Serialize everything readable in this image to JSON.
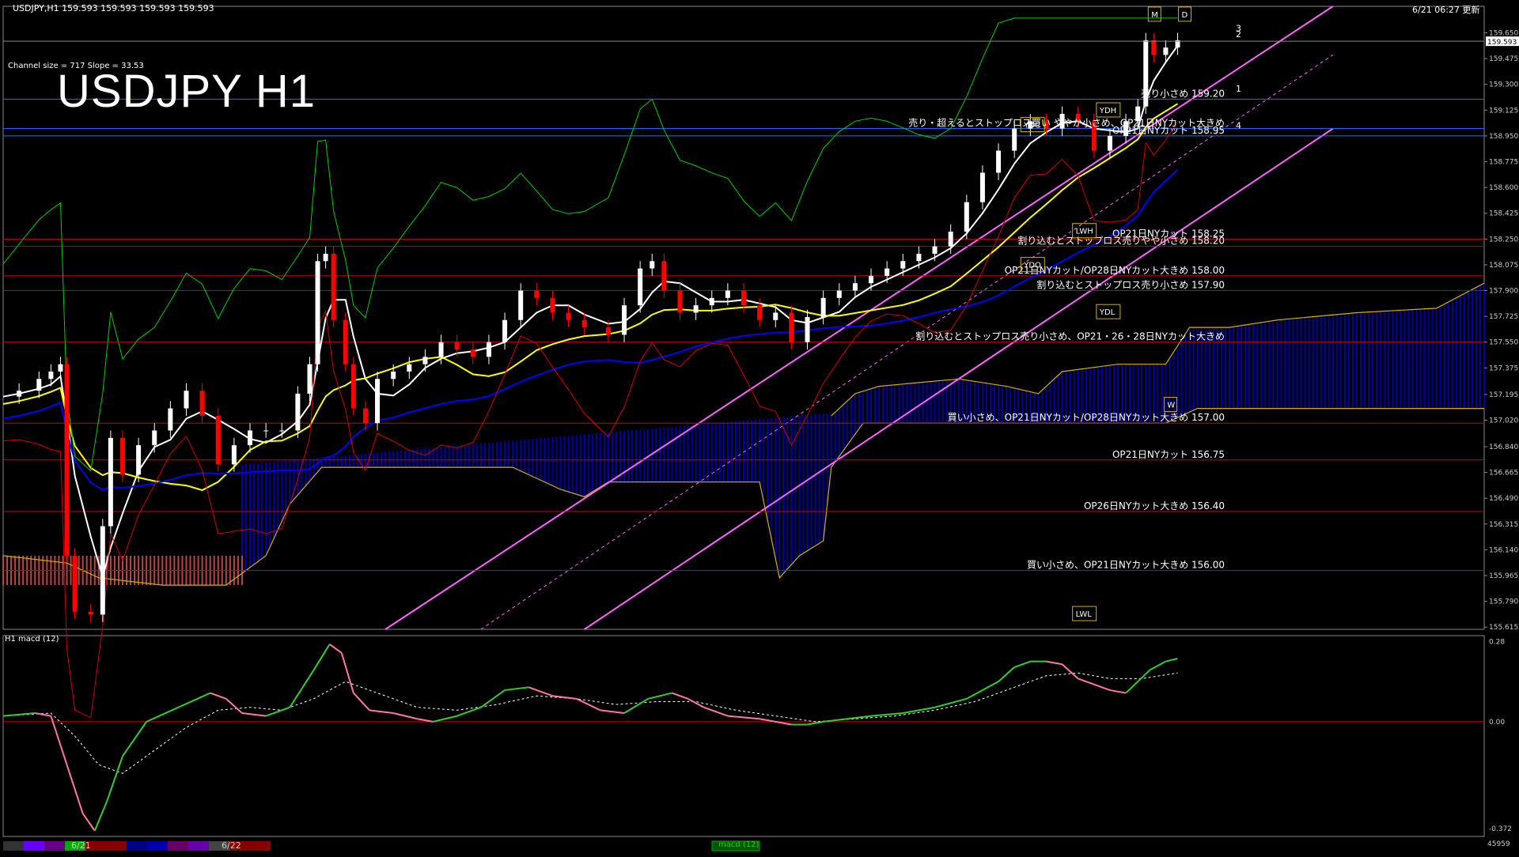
{
  "header": {
    "symbol_info": "USDJPY,H1  159.593 159.593 159.593 159.593",
    "timestamp": "6/21 06:27 更新",
    "channel_info": "Channel size = 717 Slope = 33.53",
    "big_title": "USDJPY H1",
    "macd_label": "H1  macd (12)"
  },
  "chart_data": [
    {
      "type": "line",
      "title": "USDJPY H1",
      "yaxis_ticks": [
        "159.650",
        "159.475",
        "159.300",
        "159.125",
        "158.950",
        "158.775",
        "158.600",
        "158.425",
        "158.250",
        "158.075",
        "157.900",
        "157.725",
        "157.550",
        "157.375",
        "157.195",
        "157.020",
        "156.840",
        "156.665",
        "156.490",
        "156.315",
        "156.140",
        "155.965",
        "155.790",
        "155.615"
      ],
      "ylim": [
        155.6,
        159.83
      ],
      "current_price": "159.593",
      "price_path": [
        {
          "x": 0,
          "y": 157.18
        },
        {
          "x": 20,
          "y": 157.22
        },
        {
          "x": 45,
          "y": 157.3
        },
        {
          "x": 60,
          "y": 157.35
        },
        {
          "x": 72,
          "y": 157.4
        },
        {
          "x": 80,
          "y": 156.1
        },
        {
          "x": 90,
          "y": 155.72
        },
        {
          "x": 110,
          "y": 155.7
        },
        {
          "x": 125,
          "y": 156.3
        },
        {
          "x": 135,
          "y": 156.9
        },
        {
          "x": 150,
          "y": 156.65
        },
        {
          "x": 170,
          "y": 156.85
        },
        {
          "x": 190,
          "y": 156.95
        },
        {
          "x": 210,
          "y": 157.1
        },
        {
          "x": 230,
          "y": 157.22
        },
        {
          "x": 250,
          "y": 157.05
        },
        {
          "x": 270,
          "y": 156.72
        },
        {
          "x": 290,
          "y": 156.85
        },
        {
          "x": 310,
          "y": 156.95
        },
        {
          "x": 330,
          "y": 156.95
        },
        {
          "x": 350,
          "y": 156.95
        },
        {
          "x": 370,
          "y": 157.2
        },
        {
          "x": 385,
          "y": 157.4
        },
        {
          "x": 395,
          "y": 158.1
        },
        {
          "x": 405,
          "y": 158.15
        },
        {
          "x": 415,
          "y": 157.7
        },
        {
          "x": 430,
          "y": 157.4
        },
        {
          "x": 440,
          "y": 157.1
        },
        {
          "x": 455,
          "y": 157.0
        },
        {
          "x": 470,
          "y": 157.3
        },
        {
          "x": 490,
          "y": 157.35
        },
        {
          "x": 510,
          "y": 157.4
        },
        {
          "x": 530,
          "y": 157.45
        },
        {
          "x": 550,
          "y": 157.55
        },
        {
          "x": 570,
          "y": 157.5
        },
        {
          "x": 590,
          "y": 157.45
        },
        {
          "x": 610,
          "y": 157.55
        },
        {
          "x": 630,
          "y": 157.7
        },
        {
          "x": 650,
          "y": 157.9
        },
        {
          "x": 670,
          "y": 157.85
        },
        {
          "x": 690,
          "y": 157.75
        },
        {
          "x": 710,
          "y": 157.7
        },
        {
          "x": 730,
          "y": 157.65
        },
        {
          "x": 760,
          "y": 157.6
        },
        {
          "x": 780,
          "y": 157.8
        },
        {
          "x": 800,
          "y": 158.05
        },
        {
          "x": 815,
          "y": 158.1
        },
        {
          "x": 830,
          "y": 157.9
        },
        {
          "x": 850,
          "y": 157.75
        },
        {
          "x": 870,
          "y": 157.8
        },
        {
          "x": 890,
          "y": 157.85
        },
        {
          "x": 910,
          "y": 157.9
        },
        {
          "x": 930,
          "y": 157.8
        },
        {
          "x": 950,
          "y": 157.7
        },
        {
          "x": 970,
          "y": 157.75
        },
        {
          "x": 990,
          "y": 157.55
        },
        {
          "x": 1010,
          "y": 157.72
        },
        {
          "x": 1030,
          "y": 157.85
        },
        {
          "x": 1050,
          "y": 157.9
        },
        {
          "x": 1070,
          "y": 157.95
        },
        {
          "x": 1090,
          "y": 158.0
        },
        {
          "x": 1110,
          "y": 158.05
        },
        {
          "x": 1130,
          "y": 158.1
        },
        {
          "x": 1150,
          "y": 158.15
        },
        {
          "x": 1170,
          "y": 158.2
        },
        {
          "x": 1190,
          "y": 158.3
        },
        {
          "x": 1210,
          "y": 158.5
        },
        {
          "x": 1230,
          "y": 158.7
        },
        {
          "x": 1250,
          "y": 158.85
        },
        {
          "x": 1270,
          "y": 159.0
        },
        {
          "x": 1290,
          "y": 159.05
        },
        {
          "x": 1310,
          "y": 159.0
        },
        {
          "x": 1330,
          "y": 159.1
        },
        {
          "x": 1350,
          "y": 159.05
        },
        {
          "x": 1370,
          "y": 158.85
        },
        {
          "x": 1390,
          "y": 158.95
        },
        {
          "x": 1410,
          "y": 159.05
        },
        {
          "x": 1425,
          "y": 159.15
        },
        {
          "x": 1435,
          "y": 159.6
        },
        {
          "x": 1445,
          "y": 159.5
        },
        {
          "x": 1460,
          "y": 159.55
        },
        {
          "x": 1475,
          "y": 159.6
        }
      ],
      "ichimoku_lower_span": [
        {
          "x": 0,
          "y": 156.1
        },
        {
          "x": 80,
          "y": 156.05
        },
        {
          "x": 120,
          "y": 155.95
        },
        {
          "x": 200,
          "y": 155.9
        },
        {
          "x": 280,
          "y": 155.9
        },
        {
          "x": 330,
          "y": 156.1
        },
        {
          "x": 360,
          "y": 156.45
        },
        {
          "x": 400,
          "y": 156.7
        },
        {
          "x": 480,
          "y": 156.7
        },
        {
          "x": 560,
          "y": 156.7
        },
        {
          "x": 640,
          "y": 156.7
        },
        {
          "x": 700,
          "y": 156.55
        },
        {
          "x": 730,
          "y": 156.5
        },
        {
          "x": 760,
          "y": 156.6
        },
        {
          "x": 800,
          "y": 156.6
        },
        {
          "x": 850,
          "y": 156.6
        },
        {
          "x": 900,
          "y": 156.6
        },
        {
          "x": 950,
          "y": 156.6
        },
        {
          "x": 975,
          "y": 155.95
        },
        {
          "x": 1000,
          "y": 156.1
        },
        {
          "x": 1030,
          "y": 156.2
        },
        {
          "x": 1040,
          "y": 156.7
        },
        {
          "x": 1080,
          "y": 157.0
        },
        {
          "x": 1100,
          "y": 157.0
        },
        {
          "x": 1200,
          "y": 157.0
        },
        {
          "x": 1300,
          "y": 157.0
        },
        {
          "x": 1460,
          "y": 157.0
        },
        {
          "x": 1500,
          "y": 157.1
        },
        {
          "x": 1700,
          "y": 157.1
        },
        {
          "x": 1860,
          "y": 157.1
        }
      ],
      "ichimoku_upper_span": [
        {
          "x": 1040,
          "y": 157.05
        },
        {
          "x": 1070,
          "y": 157.2
        },
        {
          "x": 1100,
          "y": 157.25
        },
        {
          "x": 1200,
          "y": 157.3
        },
        {
          "x": 1260,
          "y": 157.25
        },
        {
          "x": 1300,
          "y": 157.2
        },
        {
          "x": 1330,
          "y": 157.35
        },
        {
          "x": 1400,
          "y": 157.4
        },
        {
          "x": 1460,
          "y": 157.4
        },
        {
          "x": 1490,
          "y": 157.65
        },
        {
          "x": 1540,
          "y": 157.65
        },
        {
          "x": 1600,
          "y": 157.7
        },
        {
          "x": 1700,
          "y": 157.75
        },
        {
          "x": 1800,
          "y": 157.78
        },
        {
          "x": 1860,
          "y": 157.95
        }
      ],
      "annotations": [
        {
          "text": "売り小さめ 159.20",
          "price": 159.2
        },
        {
          "text": "売り・超えるとストップロス買い ややか小さめ、OP21日NYカット大きめ",
          "price": 159.0
        },
        {
          "text": "OP21日NYカット 158.95",
          "price": 158.95
        },
        {
          "text": "OP21日NYカット 158.25",
          "price": 158.25
        },
        {
          "text": "割り込むとストップロス売りやや小さめ 158.20",
          "price": 158.2
        },
        {
          "text": "OP21日NYカット/OP28日NYカット大きめ 158.00",
          "price": 158.0
        },
        {
          "text": "割り込むとストップロス売り小さめ 157.90",
          "price": 157.9
        },
        {
          "text": "割り込むとストップロス売り小さめ、OP21・26・28日NYカット大きめ",
          "price": 157.55
        },
        {
          "text": "買い小さめ、OP21日NYカット/OP28日NYカット大きめ 157.00",
          "price": 157.0
        },
        {
          "text": "OP21日NYカット 156.75",
          "price": 156.75
        },
        {
          "text": "OP26日NYカット大きめ 156.40",
          "price": 156.4
        },
        {
          "text": "買い小さめ、OP21日NYカット大きめ 156.00",
          "price": 156.0
        }
      ],
      "box_labels": [
        "YDC",
        "YDH",
        "YDO",
        "YDL",
        "LWH",
        "LWL",
        "M",
        "W",
        "D"
      ],
      "channel_labels": [
        "3",
        "2",
        "1",
        "4"
      ],
      "colors": {
        "background": "#000000",
        "bull": "#ffffff",
        "bear": "#ff0000",
        "ma_white": "#ffffff",
        "ma_yellow": "#ffff00",
        "ma_blue": "#0000ff",
        "channel": "#ff66ff",
        "green": "#00cc00",
        "level_red": "#cc0000",
        "level_blue": "#3366ff",
        "cloud_blue": "#0000aa"
      }
    },
    {
      "type": "line",
      "title": "H1  macd (12)",
      "yaxis_ticks": [
        "0.28",
        "0.00",
        "-0.372"
      ],
      "ylim": [
        -0.4,
        0.3
      ],
      "series": [
        {
          "name": "macd",
          "values": [
            {
              "x": 0,
              "y": 0.02
            },
            {
              "x": 40,
              "y": 0.03
            },
            {
              "x": 60,
              "y": 0.02
            },
            {
              "x": 80,
              "y": -0.15
            },
            {
              "x": 100,
              "y": -0.32
            },
            {
              "x": 115,
              "y": -0.38
            },
            {
              "x": 130,
              "y": -0.28
            },
            {
              "x": 150,
              "y": -0.12
            },
            {
              "x": 180,
              "y": 0.0
            },
            {
              "x": 220,
              "y": 0.05
            },
            {
              "x": 260,
              "y": 0.1
            },
            {
              "x": 280,
              "y": 0.08
            },
            {
              "x": 300,
              "y": 0.03
            },
            {
              "x": 330,
              "y": 0.02
            },
            {
              "x": 360,
              "y": 0.05
            },
            {
              "x": 390,
              "y": 0.18
            },
            {
              "x": 410,
              "y": 0.27
            },
            {
              "x": 425,
              "y": 0.24
            },
            {
              "x": 440,
              "y": 0.1
            },
            {
              "x": 460,
              "y": 0.04
            },
            {
              "x": 490,
              "y": 0.03
            },
            {
              "x": 520,
              "y": 0.01
            },
            {
              "x": 540,
              "y": 0.0
            },
            {
              "x": 570,
              "y": 0.02
            },
            {
              "x": 600,
              "y": 0.05
            },
            {
              "x": 630,
              "y": 0.11
            },
            {
              "x": 660,
              "y": 0.12
            },
            {
              "x": 690,
              "y": 0.09
            },
            {
              "x": 720,
              "y": 0.08
            },
            {
              "x": 750,
              "y": 0.04
            },
            {
              "x": 780,
              "y": 0.03
            },
            {
              "x": 810,
              "y": 0.08
            },
            {
              "x": 840,
              "y": 0.1
            },
            {
              "x": 860,
              "y": 0.08
            },
            {
              "x": 880,
              "y": 0.05
            },
            {
              "x": 910,
              "y": 0.02
            },
            {
              "x": 950,
              "y": 0.01
            },
            {
              "x": 990,
              "y": -0.01
            },
            {
              "x": 1010,
              "y": -0.01
            },
            {
              "x": 1030,
              "y": 0.0
            },
            {
              "x": 1060,
              "y": 0.01
            },
            {
              "x": 1090,
              "y": 0.02
            },
            {
              "x": 1130,
              "y": 0.03
            },
            {
              "x": 1170,
              "y": 0.05
            },
            {
              "x": 1210,
              "y": 0.08
            },
            {
              "x": 1250,
              "y": 0.14
            },
            {
              "x": 1270,
              "y": 0.19
            },
            {
              "x": 1290,
              "y": 0.21
            },
            {
              "x": 1310,
              "y": 0.21
            },
            {
              "x": 1330,
              "y": 0.2
            },
            {
              "x": 1350,
              "y": 0.15
            },
            {
              "x": 1370,
              "y": 0.13
            },
            {
              "x": 1390,
              "y": 0.11
            },
            {
              "x": 1410,
              "y": 0.1
            },
            {
              "x": 1425,
              "y": 0.14
            },
            {
              "x": 1440,
              "y": 0.18
            },
            {
              "x": 1460,
              "y": 0.21
            },
            {
              "x": 1475,
              "y": 0.22
            }
          ]
        },
        {
          "name": "signal",
          "values": [
            {
              "x": 0,
              "y": 0.02
            },
            {
              "x": 60,
              "y": 0.03
            },
            {
              "x": 90,
              "y": -0.05
            },
            {
              "x": 120,
              "y": -0.15
            },
            {
              "x": 150,
              "y": -0.18
            },
            {
              "x": 190,
              "y": -0.1
            },
            {
              "x": 230,
              "y": -0.02
            },
            {
              "x": 270,
              "y": 0.04
            },
            {
              "x": 310,
              "y": 0.05
            },
            {
              "x": 350,
              "y": 0.04
            },
            {
              "x": 390,
              "y": 0.08
            },
            {
              "x": 430,
              "y": 0.14
            },
            {
              "x": 470,
              "y": 0.1
            },
            {
              "x": 520,
              "y": 0.05
            },
            {
              "x": 570,
              "y": 0.04
            },
            {
              "x": 620,
              "y": 0.06
            },
            {
              "x": 670,
              "y": 0.09
            },
            {
              "x": 720,
              "y": 0.08
            },
            {
              "x": 770,
              "y": 0.06
            },
            {
              "x": 820,
              "y": 0.07
            },
            {
              "x": 870,
              "y": 0.07
            },
            {
              "x": 920,
              "y": 0.04
            },
            {
              "x": 970,
              "y": 0.02
            },
            {
              "x": 1020,
              "y": 0.0
            },
            {
              "x": 1070,
              "y": 0.01
            },
            {
              "x": 1120,
              "y": 0.02
            },
            {
              "x": 1170,
              "y": 0.04
            },
            {
              "x": 1220,
              "y": 0.07
            },
            {
              "x": 1270,
              "y": 0.12
            },
            {
              "x": 1310,
              "y": 0.16
            },
            {
              "x": 1350,
              "y": 0.17
            },
            {
              "x": 1390,
              "y": 0.15
            },
            {
              "x": 1430,
              "y": 0.15
            },
            {
              "x": 1475,
              "y": 0.17
            }
          ]
        }
      ]
    }
  ],
  "bottom_bar": {
    "tab_labels": [
      "6/21",
      "6/22"
    ],
    "macd_tag": "macd (12)",
    "corner_value": "45959"
  }
}
